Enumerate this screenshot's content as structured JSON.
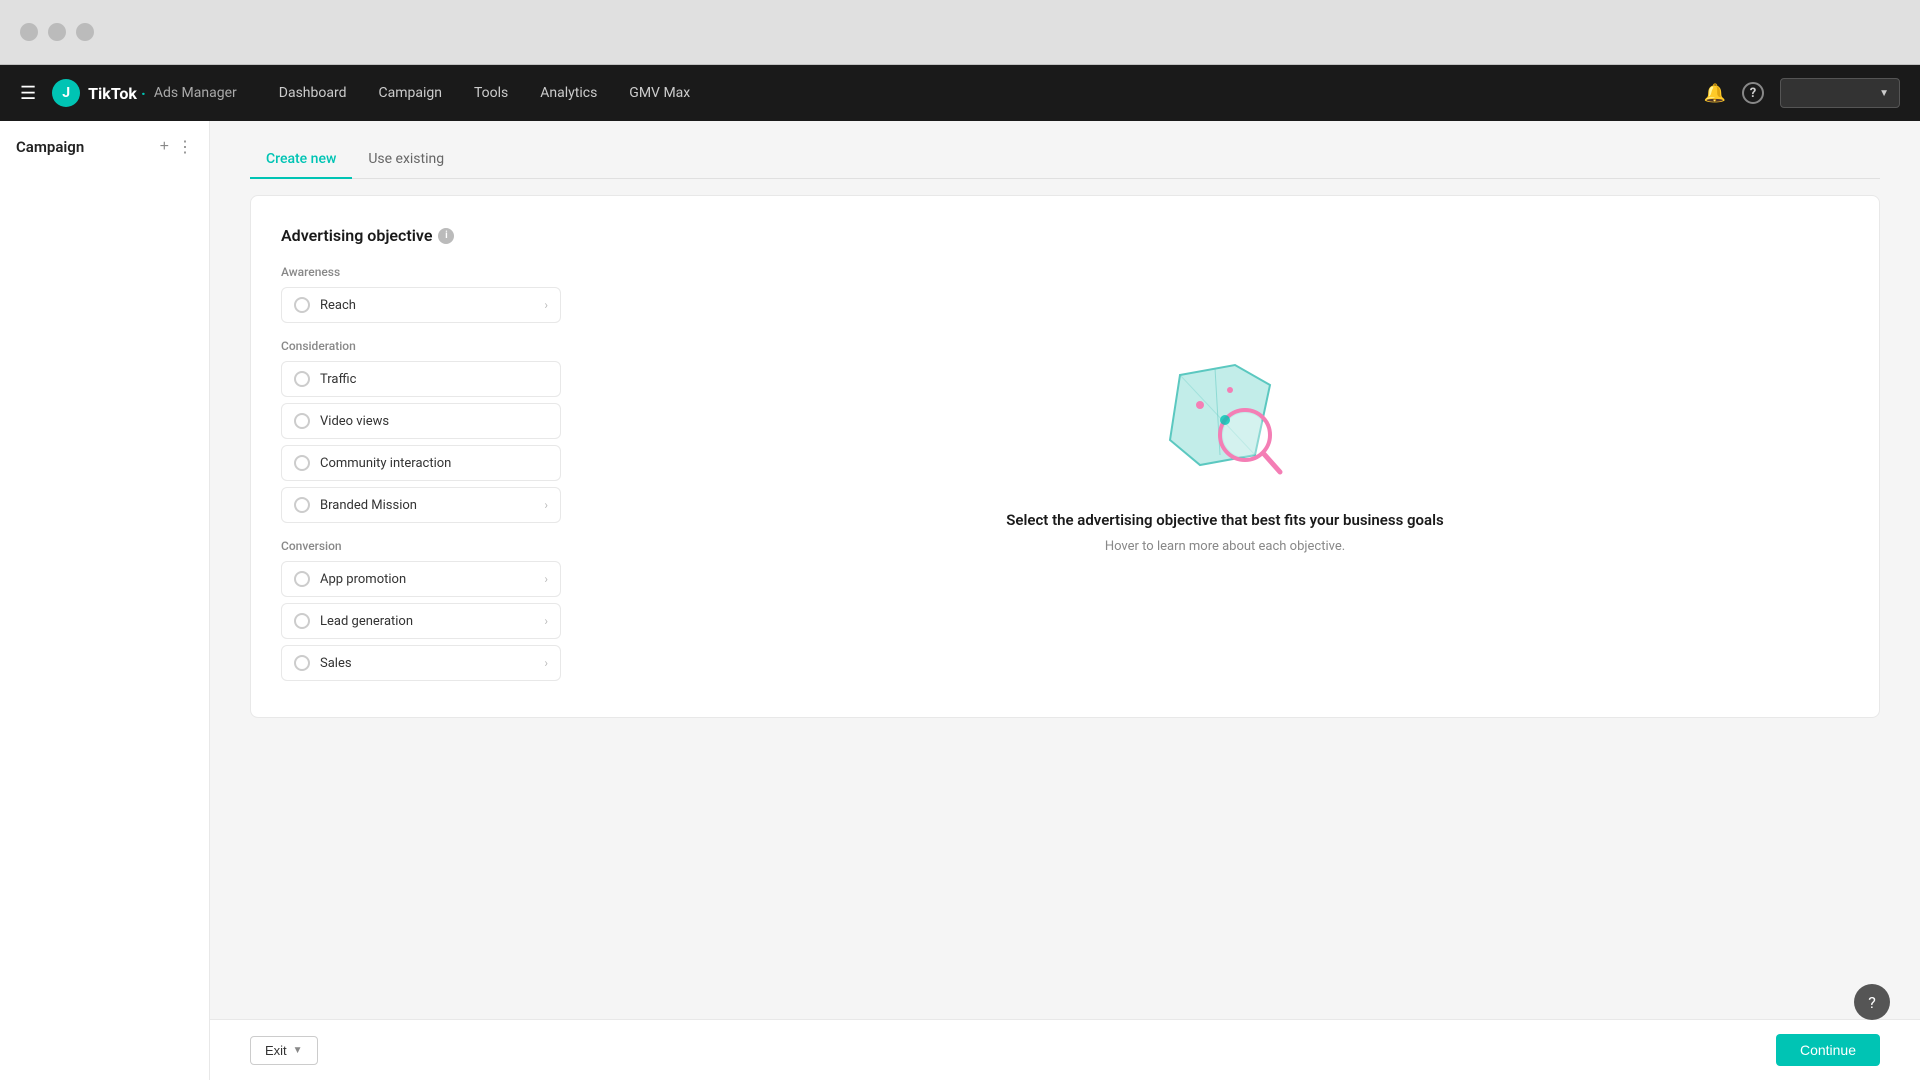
{
  "browser": {
    "dots": [
      "dot1",
      "dot2",
      "dot3"
    ]
  },
  "topnav": {
    "avatar_letter": "J",
    "brand_tiktok": "TikTok",
    "brand_dot": "·",
    "brand_adsmanager": "Ads Manager",
    "nav_items": [
      {
        "label": "Dashboard",
        "id": "dashboard"
      },
      {
        "label": "Campaign",
        "id": "campaign"
      },
      {
        "label": "Tools",
        "id": "tools"
      },
      {
        "label": "Analytics",
        "id": "analytics"
      },
      {
        "label": "GMV Max",
        "id": "gmvmax"
      }
    ],
    "bell_icon": "🔔",
    "help_icon": "?",
    "dropdown_placeholder": ""
  },
  "sidebar": {
    "title": "Campaign",
    "add_icon": "+",
    "more_icon": "⋮"
  },
  "tabs": [
    {
      "label": "Create new",
      "id": "create-new",
      "active": true
    },
    {
      "label": "Use existing",
      "id": "use-existing",
      "active": false
    }
  ],
  "advertising_objective": {
    "title": "Advertising objective",
    "info_tooltip": "i",
    "categories": [
      {
        "id": "awareness",
        "label": "Awareness",
        "items": [
          {
            "id": "reach",
            "label": "Reach",
            "has_arrow": true
          }
        ]
      },
      {
        "id": "consideration",
        "label": "Consideration",
        "items": [
          {
            "id": "traffic",
            "label": "Traffic",
            "has_arrow": false
          },
          {
            "id": "video-views",
            "label": "Video views",
            "has_arrow": false
          },
          {
            "id": "community-interaction",
            "label": "Community interaction",
            "has_arrow": false
          },
          {
            "id": "branded-mission",
            "label": "Branded Mission",
            "has_arrow": true
          }
        ]
      },
      {
        "id": "conversion",
        "label": "Conversion",
        "items": [
          {
            "id": "app-promotion",
            "label": "App promotion",
            "has_arrow": true
          },
          {
            "id": "lead-generation",
            "label": "Lead generation",
            "has_arrow": true
          },
          {
            "id": "sales",
            "label": "Sales",
            "has_arrow": true
          }
        ]
      }
    ]
  },
  "info_panel": {
    "heading": "Select the advertising objective that best fits your business goals",
    "subtext": "Hover to learn more about each objective."
  },
  "bottom_bar": {
    "exit_label": "Exit",
    "continue_label": "Continue"
  },
  "help_fab": "?"
}
